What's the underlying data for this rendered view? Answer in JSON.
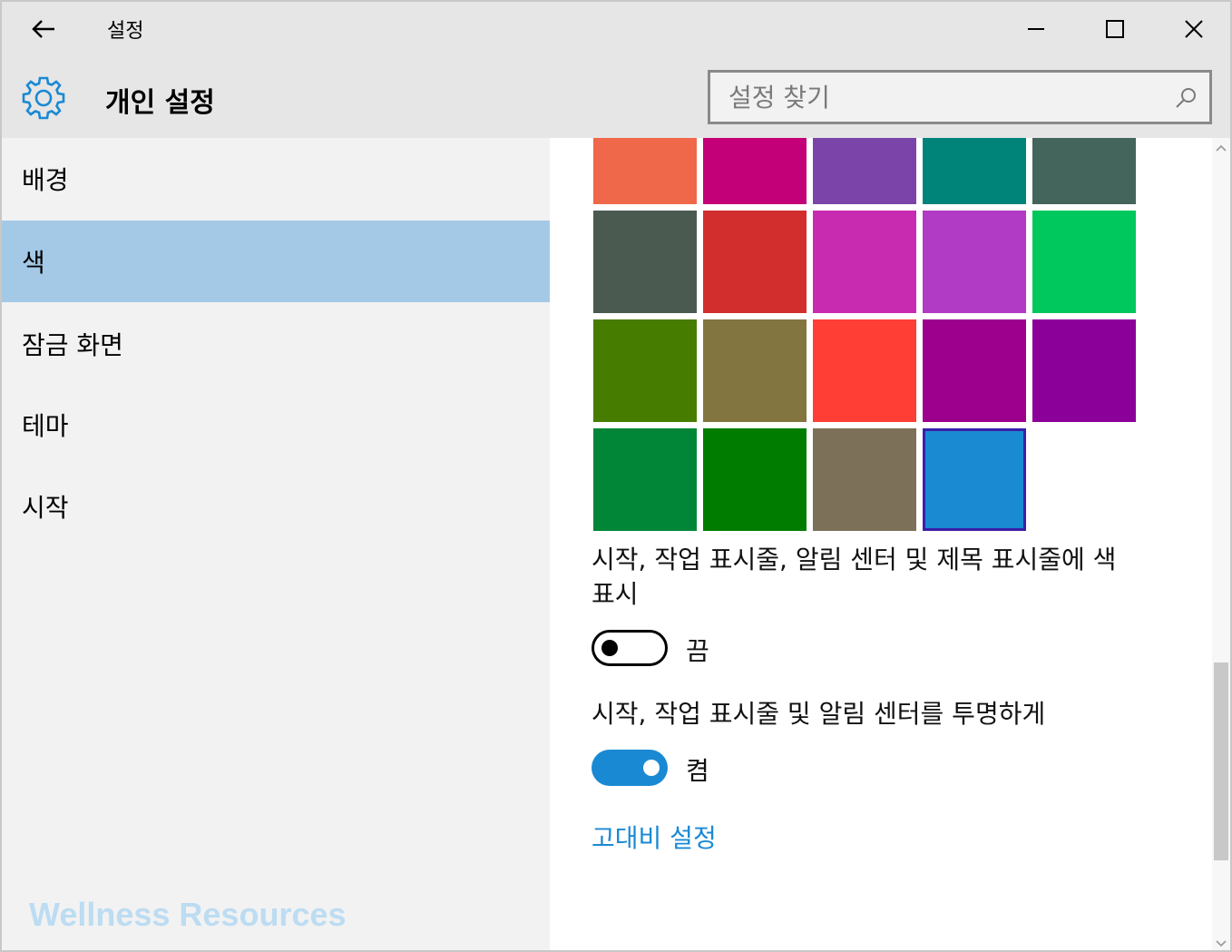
{
  "window": {
    "title": "설정",
    "back_icon": "back-arrow-icon",
    "min_icon": "minimize-icon",
    "max_icon": "maximize-icon",
    "close_icon": "close-icon"
  },
  "header": {
    "icon": "gear-icon",
    "title": "개인 설정",
    "accent": "#1a89d3"
  },
  "search": {
    "placeholder": "설정 찾기",
    "icon": "search-icon"
  },
  "sidebar": {
    "items": [
      {
        "label": "배경",
        "selected": false
      },
      {
        "label": "색",
        "selected": true
      },
      {
        "label": "잠금 화면",
        "selected": false
      },
      {
        "label": "테마",
        "selected": false
      },
      {
        "label": "시작",
        "selected": false
      }
    ],
    "selected_color": "#a3c9e7",
    "watermark": "Wellness Resources"
  },
  "colors": {
    "swatches": [
      [
        "#f0684a",
        "#c40078",
        "#7b44a8",
        "#00847a",
        "#44655c"
      ],
      [
        "#4b5a50",
        "#d22e2e",
        "#c92bb0",
        "#b13bc5",
        "#00c85c"
      ],
      [
        "#467d00",
        "#837540",
        "#ff3e35",
        "#9c008c",
        "#8c009a"
      ],
      [
        "#008636",
        "#007d00",
        "#7d7058",
        "#1a8ad3"
      ]
    ],
    "selected_swatch": "#1a8ad3"
  },
  "options": {
    "show_color_label_1": "시작, 작업 표시줄, 알림 센터 및 제목 표시줄에 색",
    "show_color_label_2": "표시",
    "show_color_state": "끔",
    "show_color_on": false,
    "transparency_label": "시작, 작업 표시줄 및 알림 센터를 투명하게",
    "transparency_state": "켬",
    "transparency_on": true,
    "high_contrast_link": "고대비 설정"
  }
}
